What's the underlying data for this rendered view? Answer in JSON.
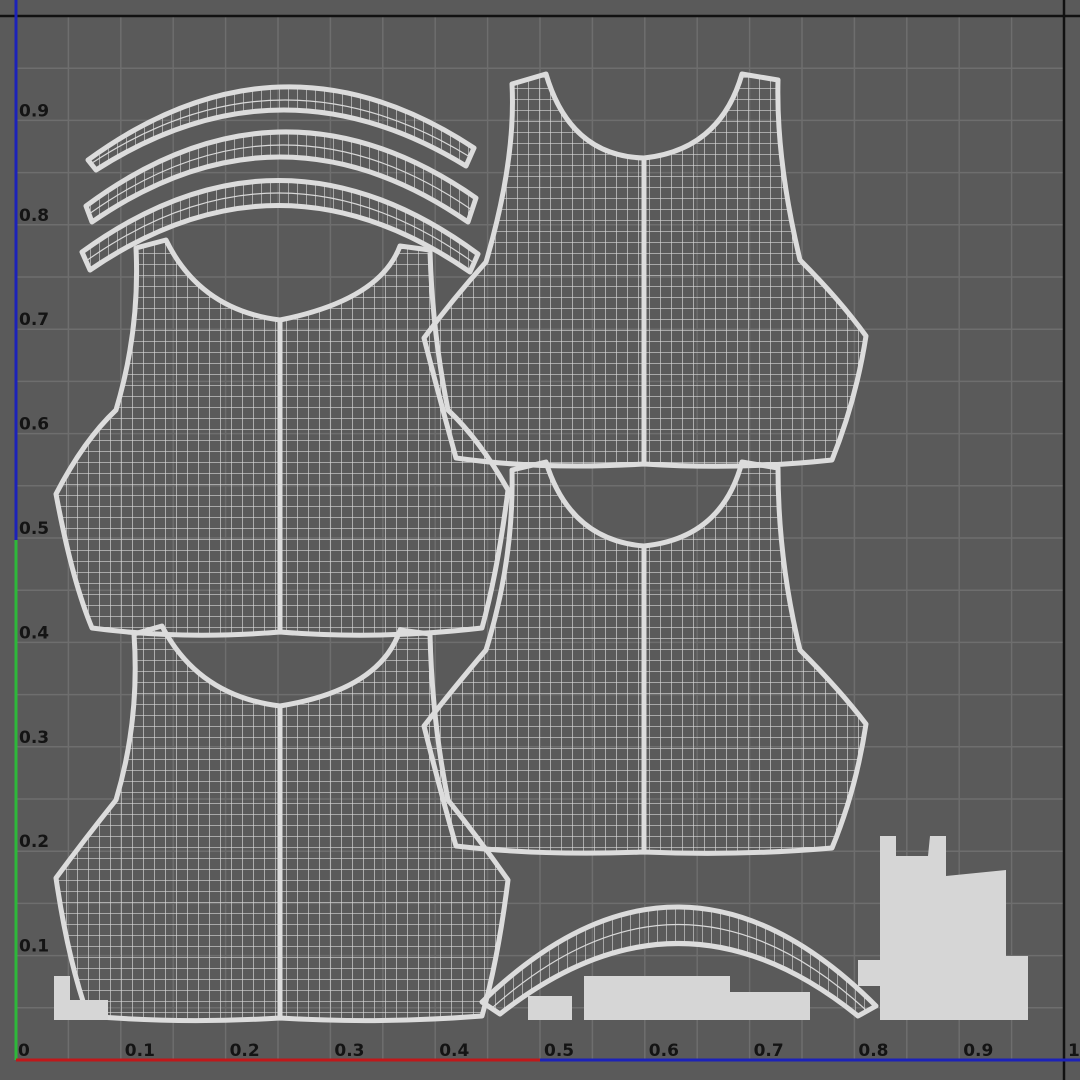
{
  "editor": {
    "background": "#5a5a5a",
    "grid_color": "#6e6e6e",
    "wire_color": "#dcdcdc",
    "u_axis_color": "#c0181a",
    "v_axis_color": "#2db83a",
    "outer_axis_color": "#1c22b8"
  },
  "u_axis": {
    "ticks": [
      "0",
      "0.1",
      "0.2",
      "0.3",
      "0.4",
      "0.5",
      "0.6",
      "0.7",
      "0.8",
      "0.9",
      "1"
    ],
    "values": [
      0,
      0.1,
      0.2,
      0.3,
      0.4,
      0.5,
      0.6,
      0.7,
      0.8,
      0.9,
      1
    ]
  },
  "v_axis": {
    "ticks": [
      "0.1",
      "0.2",
      "0.3",
      "0.4",
      "0.5",
      "0.6",
      "0.7",
      "0.8",
      "0.9"
    ],
    "values": [
      0.1,
      0.2,
      0.3,
      0.4,
      0.5,
      0.6,
      0.7,
      0.8,
      0.9
    ]
  },
  "shells": [
    "strap-shell-1",
    "strap-shell-2",
    "strap-shell-3",
    "bodice-shell-top-left",
    "bodice-shell-top-right",
    "bodice-shell-bottom-left",
    "bodice-shell-bottom-right",
    "arch-shell-bottom",
    "packed-islands-right",
    "packed-islands-bottom"
  ]
}
